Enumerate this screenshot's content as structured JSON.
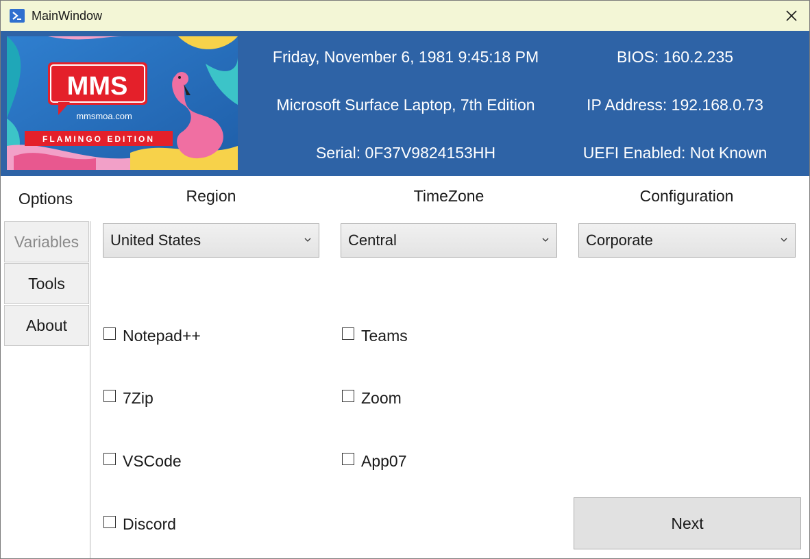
{
  "window": {
    "title": "MainWindow"
  },
  "header": {
    "datetime": "Friday, November 6, 1981 9:45:18 PM",
    "model": "Microsoft Surface Laptop, 7th Edition",
    "serial": "Serial: 0F37V9824153HH",
    "bios": "BIOS: 160.2.235",
    "ip": "IP Address: 192.168.0.73",
    "uefi": "UEFI Enabled: Not Known",
    "banner": {
      "logo_text": "MMS",
      "site": "mmsmoa.com",
      "edition": "FLAMINGO EDITION"
    }
  },
  "tabs": [
    {
      "label": "Options"
    },
    {
      "label": "Variables"
    },
    {
      "label": "Tools"
    },
    {
      "label": "About"
    }
  ],
  "options": {
    "region": {
      "label": "Region",
      "value": "United States"
    },
    "timezone": {
      "label": "TimeZone",
      "value": "Central"
    },
    "configuration": {
      "label": "Configuration",
      "value": "Corporate"
    },
    "apps_left": [
      "Notepad++",
      "7Zip",
      "VSCode",
      "Discord"
    ],
    "apps_right": [
      "Teams",
      "Zoom",
      "App07"
    ],
    "next_label": "Next"
  },
  "colors": {
    "header_bg": "#2e63a6",
    "titlebar_bg": "#f3f6d6",
    "banner_red": "#e4202a",
    "flamingo_pink": "#f06fa2"
  }
}
